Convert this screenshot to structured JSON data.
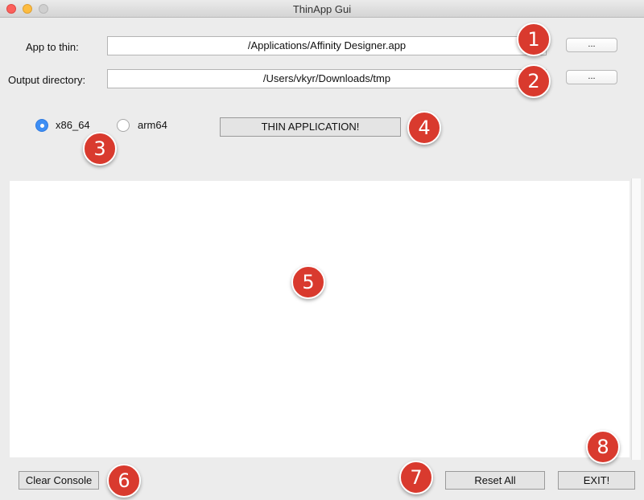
{
  "window": {
    "title": "ThinApp Gui"
  },
  "form": {
    "app_label": "App to thin:",
    "app_value": "/Applications/Affinity Designer.app",
    "app_browse": "...",
    "output_label": "Output directory:",
    "output_value": "/Users/vkyr/Downloads/tmp",
    "output_browse": "..."
  },
  "arch": {
    "options": [
      {
        "label": "x86_64",
        "selected": true
      },
      {
        "label": "arm64",
        "selected": false
      }
    ]
  },
  "thin_button": "THIN APPLICATION!",
  "footer": {
    "clear_console": "Clear Console",
    "reset_all": "Reset All",
    "exit": "EXIT!"
  },
  "badges": [
    "1",
    "2",
    "3",
    "4",
    "5",
    "6",
    "7",
    "8"
  ],
  "colors": {
    "badge": "#d93a2e",
    "radio_selected": "#3d8ef4"
  }
}
